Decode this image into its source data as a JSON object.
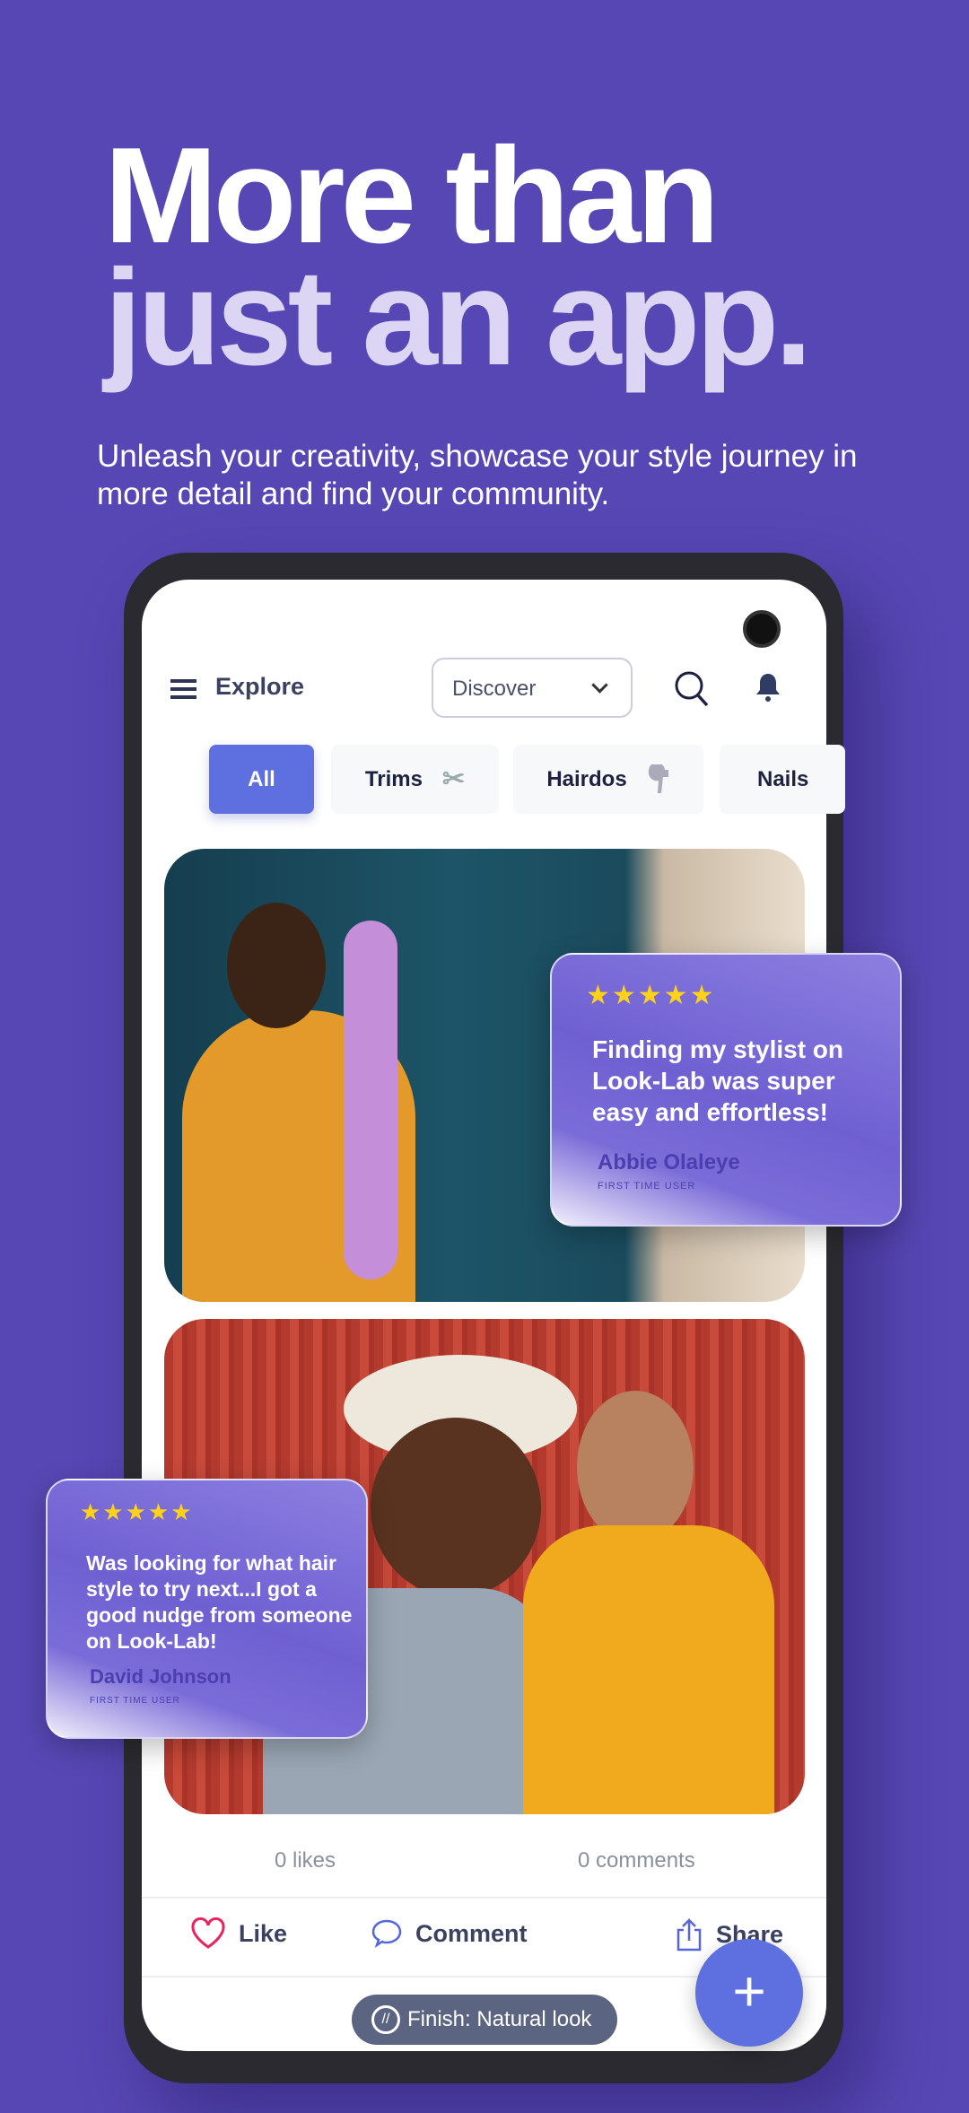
{
  "hero": {
    "title_line1": "More than",
    "title_line2": "just an app.",
    "subtitle": "Unleash your creativity, showcase your style journey in more detail and find your community."
  },
  "app": {
    "header": {
      "title": "Explore",
      "dropdown_value": "Discover"
    },
    "chips": [
      {
        "label": "All",
        "active": true
      },
      {
        "label": "Trims",
        "icon": "scissors-icon"
      },
      {
        "label": "Hairdos",
        "icon": "hair-dryer-icon"
      },
      {
        "label": "Nails"
      }
    ],
    "post": {
      "likes": "0 likes",
      "comments": "0 comments",
      "like_label": "Like",
      "comment_label": "Comment",
      "share_label": "Share",
      "finish_tag": "Finish: Natural look"
    },
    "fab_label": "+"
  },
  "reviews": [
    {
      "stars": "★★★★★",
      "rating": 5,
      "quote": "Finding my stylist on Look-Lab was super easy and effortless!",
      "name": "Abbie Olaleye",
      "role": "FIRST TIME USER"
    },
    {
      "stars": "★★★★★",
      "rating": 5,
      "quote": "Was looking for what hair style to try next...I got a good nudge from someone on Look-Lab!",
      "name": "David Johnson",
      "role": "FIRST TIME USER"
    }
  ],
  "colors": {
    "background": "#5747b4",
    "accent": "#5e6fdf",
    "star": "#ffd21a",
    "like": "#e8245c"
  }
}
